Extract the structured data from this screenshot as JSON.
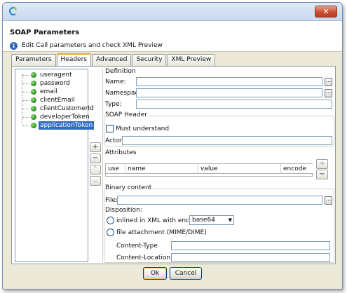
{
  "window": {
    "title": "",
    "close_glyph": "✕"
  },
  "header": {
    "title": "SOAP Parameters",
    "description": "Edit Call parameters and check XML Preview"
  },
  "tabs": [
    {
      "label": "Parameters",
      "active": false
    },
    {
      "label": "Headers",
      "active": true
    },
    {
      "label": "Advanced",
      "active": false
    },
    {
      "label": "Security",
      "active": false
    },
    {
      "label": "XML Preview",
      "active": false
    }
  ],
  "tree": {
    "items": [
      {
        "label": "useragent",
        "selected": false
      },
      {
        "label": "password",
        "selected": false
      },
      {
        "label": "email",
        "selected": false
      },
      {
        "label": "clientEmail",
        "selected": false
      },
      {
        "label": "clientCustomerId",
        "selected": false
      },
      {
        "label": "developerToken",
        "selected": false
      },
      {
        "label": "applicationToken",
        "selected": true
      }
    ]
  },
  "side_buttons": {
    "add": "+",
    "remove": "−",
    "up": "⌃",
    "down": "⌄"
  },
  "definition": {
    "section_label": "Definition",
    "name_label": "Name:",
    "name_value": "",
    "namespace_label": "Namespace:",
    "namespace_value": "",
    "type_label": "Type:",
    "type_value": "",
    "browse_glyph": "..."
  },
  "soap_header": {
    "section_label": "SOAP Header",
    "must_understand_label": "Must understand",
    "must_understand_checked": false,
    "actor_label": "Actor",
    "actor_value": ""
  },
  "attributes": {
    "section_label": "Attributes",
    "columns": [
      "use",
      "name",
      "value",
      "encode"
    ],
    "add": "+",
    "remove": "−"
  },
  "binary_content": {
    "section_label": "Binary content",
    "file_label": "File:",
    "file_value": "",
    "browse_glyph": "...",
    "disposition_label": "Disposition:",
    "inline_label": "inlined in XML with encoding:",
    "encoding_selected": "base64",
    "attachment_label": "file attachment (MIME/DIME)",
    "content_type_label": "Content-Type",
    "content_type_value": "",
    "content_location_label": "Content-Location",
    "content_location_value": ""
  },
  "footer": {
    "ok_label": "Ok",
    "cancel_label": "Cancel"
  },
  "colors": {
    "selection": "#316ac5",
    "tab_accent": "#e5a93c",
    "window_bg": "#ece9d8"
  }
}
